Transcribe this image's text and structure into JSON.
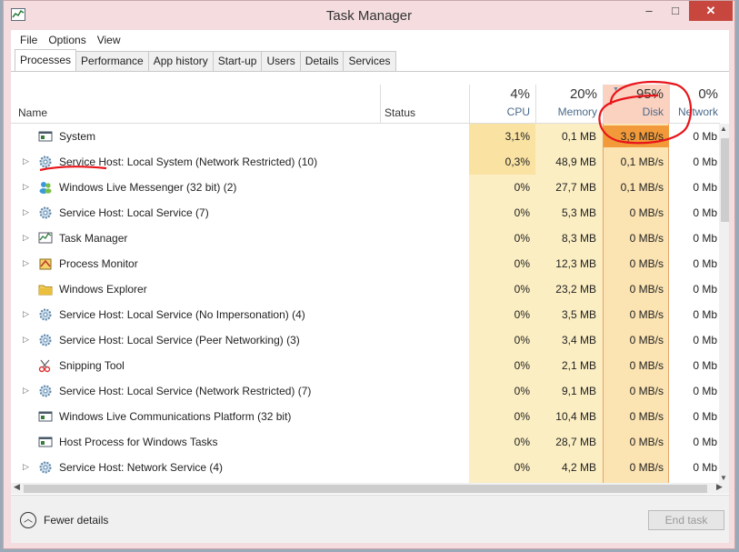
{
  "window": {
    "title": "Task Manager",
    "minimize_glyph": "–",
    "maximize_glyph": "□",
    "close_glyph": "✕"
  },
  "menu": [
    "File",
    "Options",
    "View"
  ],
  "tabs": [
    "Processes",
    "Performance",
    "App history",
    "Start-up",
    "Users",
    "Details",
    "Services"
  ],
  "active_tab": "Processes",
  "columns": {
    "name": "Name",
    "status": "Status",
    "cpu": {
      "pct": "4%",
      "label": "CPU"
    },
    "memory": {
      "pct": "20%",
      "label": "Memory"
    },
    "disk": {
      "pct": "95%",
      "label": "Disk"
    },
    "network": {
      "pct": "0%",
      "label": "Network"
    }
  },
  "processes": [
    {
      "name": "System",
      "expandable": false,
      "icon": "window-icon",
      "cpu": "3,1%",
      "memory": "0,1 MB",
      "disk": "3,9 MB/s",
      "network": "0 Mb"
    },
    {
      "name": "Service Host: Local System (Network Restricted) (10)",
      "expandable": true,
      "icon": "gear-icon",
      "cpu": "0,3%",
      "memory": "48,9 MB",
      "disk": "0,1 MB/s",
      "network": "0 Mb"
    },
    {
      "name": "Windows Live Messenger (32 bit) (2)",
      "expandable": true,
      "icon": "messenger-icon",
      "cpu": "0%",
      "memory": "27,7 MB",
      "disk": "0,1 MB/s",
      "network": "0 Mb"
    },
    {
      "name": "Service Host: Local Service (7)",
      "expandable": true,
      "icon": "gear-icon",
      "cpu": "0%",
      "memory": "5,3 MB",
      "disk": "0 MB/s",
      "network": "0 Mb"
    },
    {
      "name": "Task Manager",
      "expandable": true,
      "icon": "taskmanager-icon",
      "cpu": "0%",
      "memory": "8,3 MB",
      "disk": "0 MB/s",
      "network": "0 Mb"
    },
    {
      "name": "Process Monitor",
      "expandable": true,
      "icon": "process-monitor-icon",
      "cpu": "0%",
      "memory": "12,3 MB",
      "disk": "0 MB/s",
      "network": "0 Mb"
    },
    {
      "name": "Windows Explorer",
      "expandable": false,
      "icon": "folder-icon",
      "cpu": "0%",
      "memory": "23,2 MB",
      "disk": "0 MB/s",
      "network": "0 Mb"
    },
    {
      "name": "Service Host: Local Service (No Impersonation) (4)",
      "expandable": true,
      "icon": "gear-icon",
      "cpu": "0%",
      "memory": "3,5 MB",
      "disk": "0 MB/s",
      "network": "0 Mb"
    },
    {
      "name": "Service Host: Local Service (Peer Networking) (3)",
      "expandable": true,
      "icon": "gear-icon",
      "cpu": "0%",
      "memory": "3,4 MB",
      "disk": "0 MB/s",
      "network": "0 Mb"
    },
    {
      "name": "Snipping Tool",
      "expandable": false,
      "icon": "scissors-icon",
      "cpu": "0%",
      "memory": "2,1 MB",
      "disk": "0 MB/s",
      "network": "0 Mb"
    },
    {
      "name": "Service Host: Local Service (Network Restricted) (7)",
      "expandable": true,
      "icon": "gear-icon",
      "cpu": "0%",
      "memory": "9,1 MB",
      "disk": "0 MB/s",
      "network": "0 Mb"
    },
    {
      "name": "Windows Live Communications Platform (32 bit)",
      "expandable": false,
      "icon": "window-icon",
      "cpu": "0%",
      "memory": "10,4 MB",
      "disk": "0 MB/s",
      "network": "0 Mb"
    },
    {
      "name": "Host Process for Windows Tasks",
      "expandable": false,
      "icon": "window-icon",
      "cpu": "0%",
      "memory": "28,7 MB",
      "disk": "0 MB/s",
      "network": "0 Mb"
    },
    {
      "name": "Service Host: Network Service (4)",
      "expandable": true,
      "icon": "gear-icon",
      "cpu": "0%",
      "memory": "4,2 MB",
      "disk": "0 MB/s",
      "network": "0 Mb"
    }
  ],
  "footer": {
    "fewer_details": "Fewer details",
    "end_task": "End task"
  },
  "colors": {
    "cpu_heat": "#fbeec2",
    "cpu_heat_strong": "#f9e2a2",
    "memory_heat": "#fbeec2",
    "disk_heat": "#fbe3b2",
    "disk_highlight": "#f29a3a",
    "close_button": "#c7473e",
    "annotation": "#e8141a"
  }
}
